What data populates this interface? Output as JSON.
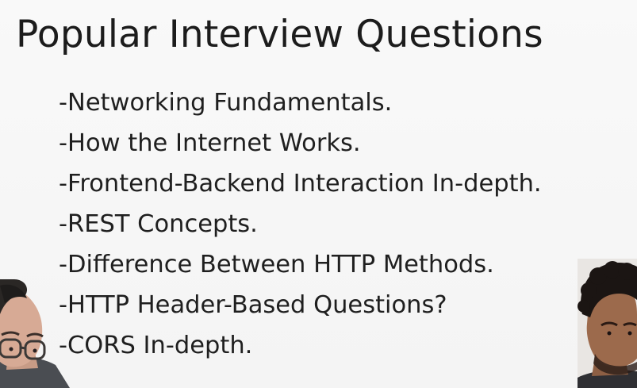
{
  "slide": {
    "title": "Popular Interview Questions",
    "items": [
      "-Networking Fundamentals.",
      "-How the Internet Works.",
      "-Frontend-Backend Interaction In-depth.",
      "-REST Concepts.",
      "-Difference Between HTTP Methods.",
      "-HTTP Header-Based Questions?",
      "-CORS In-depth."
    ]
  },
  "colors": {
    "background": "#f7f7f7",
    "text": "#1f1f1f"
  }
}
